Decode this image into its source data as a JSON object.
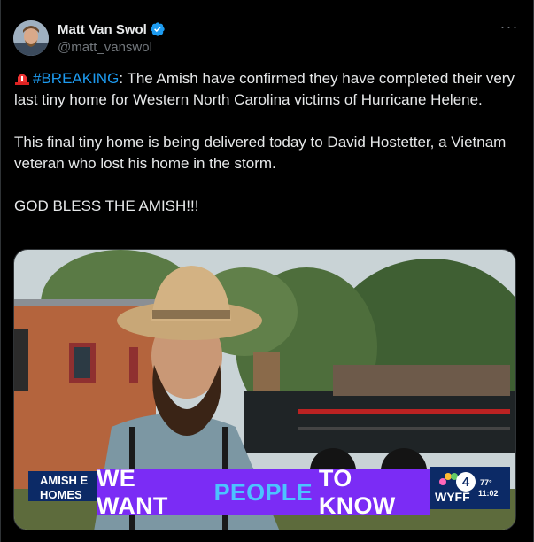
{
  "author": {
    "display_name": "Matt Van Swol",
    "handle": "@matt_vanswol",
    "verified": true
  },
  "more_menu": "···",
  "tweet": {
    "hashtag": "#BREAKING",
    "line1_rest": ": The Amish have confirmed they have completed their very last tiny home for Western North Carolina victims of Hurricane Helene.",
    "line2": "This final tiny home is being delivered today to David Hostetter, a Vietnam veteran who lost his home in the storm.",
    "line3": "GOD BLESS THE AMISH!!!"
  },
  "video": {
    "lower_third_line1": "AMISH E",
    "lower_third_line2": "HOMES",
    "caption_before": "WE WANT",
    "caption_highlight": "PEOPLE",
    "caption_after": "TO KNOW",
    "channel_number": "4",
    "station": "WYFF",
    "temperature": "77°",
    "time": "11:02"
  },
  "colors": {
    "background": "#000000",
    "accent": "#1d9bf0",
    "caption_bg": "#7b2cf5",
    "caption_highlight": "#4cc3ff"
  },
  "icons": [
    "verified-badge-icon",
    "siren-emoji-icon",
    "more-options-icon",
    "nbc-peacock-icon"
  ]
}
